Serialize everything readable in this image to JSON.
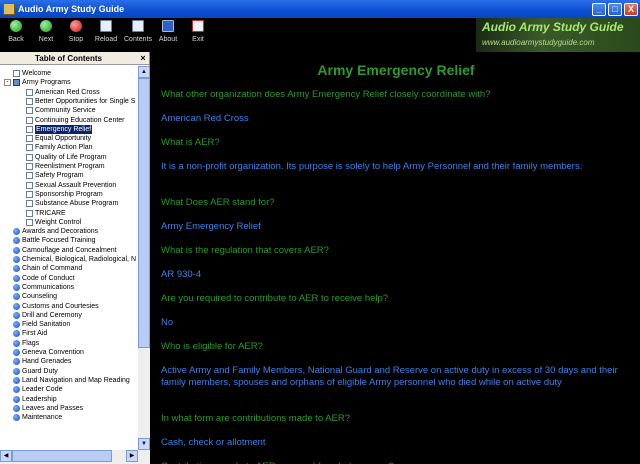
{
  "window": {
    "title": "Audio Army Study Guide",
    "min": "_",
    "max": "□",
    "close": "X"
  },
  "toolbar": {
    "back": "Back",
    "next": "Next",
    "stop": "Stop",
    "reload": "Reload",
    "contents": "Contents",
    "about": "About",
    "exit": "Exit",
    "logo_title": "Audio Army Study Guide",
    "logo_url": "www.audioarmystudyguide.com"
  },
  "toc": {
    "title": "Table of Contents",
    "close": "×",
    "items": [
      {
        "label": "Welcome",
        "icon": "page",
        "level": 1
      },
      {
        "label": "Army Programs",
        "icon": "book",
        "level": 1
      },
      {
        "label": "American Red Cross",
        "icon": "page",
        "level": 2
      },
      {
        "label": "Better Opportunities for Single S",
        "icon": "page",
        "level": 2
      },
      {
        "label": "Community Service",
        "icon": "page",
        "level": 2
      },
      {
        "label": "Continuing Education Center",
        "icon": "page",
        "level": 2
      },
      {
        "label": "Emergency Relief",
        "icon": "page",
        "level": 2,
        "selected": true
      },
      {
        "label": "Equal Opportunity",
        "icon": "page",
        "level": 2
      },
      {
        "label": "Family Action Plan",
        "icon": "page",
        "level": 2
      },
      {
        "label": "Quality of Life Program",
        "icon": "page",
        "level": 2
      },
      {
        "label": "Reenlistment Program",
        "icon": "page",
        "level": 2
      },
      {
        "label": "Safety Program",
        "icon": "page",
        "level": 2
      },
      {
        "label": "Sexual Assault Prevention",
        "icon": "page",
        "level": 2
      },
      {
        "label": "Sponsorship Program",
        "icon": "page",
        "level": 2
      },
      {
        "label": "Substance Abuse Program",
        "icon": "page",
        "level": 2
      },
      {
        "label": "TRICARE",
        "icon": "page",
        "level": 2
      },
      {
        "label": "Weight Control",
        "icon": "page",
        "level": 2
      },
      {
        "label": "Awards and Decorations",
        "icon": "q",
        "level": 1
      },
      {
        "label": "Battle Focused Training",
        "icon": "q",
        "level": 1
      },
      {
        "label": "Camouflage and Concealment",
        "icon": "q",
        "level": 1
      },
      {
        "label": "Chemical, Biological, Radiological, N",
        "icon": "q",
        "level": 1
      },
      {
        "label": "Chain of Command",
        "icon": "q",
        "level": 1
      },
      {
        "label": "Code of Conduct",
        "icon": "q",
        "level": 1
      },
      {
        "label": "Communications",
        "icon": "q",
        "level": 1
      },
      {
        "label": "Counseling",
        "icon": "q",
        "level": 1
      },
      {
        "label": "Customs and Courtesies",
        "icon": "q",
        "level": 1
      },
      {
        "label": "Drill and Ceremony",
        "icon": "q",
        "level": 1
      },
      {
        "label": "Field Sanitation",
        "icon": "q",
        "level": 1
      },
      {
        "label": "First Aid",
        "icon": "q",
        "level": 1
      },
      {
        "label": "Flags",
        "icon": "q",
        "level": 1
      },
      {
        "label": "Geneva Convention",
        "icon": "q",
        "level": 1
      },
      {
        "label": "Hand Grenades",
        "icon": "q",
        "level": 1
      },
      {
        "label": "Guard Duty",
        "icon": "q",
        "level": 1
      },
      {
        "label": "Land Navigation and Map Reading",
        "icon": "q",
        "level": 1
      },
      {
        "label": "Leader Code",
        "icon": "q",
        "level": 1
      },
      {
        "label": "Leadership",
        "icon": "q",
        "level": 1
      },
      {
        "label": "Leaves and Passes",
        "icon": "q",
        "level": 1
      },
      {
        "label": "Maintenance",
        "icon": "q",
        "level": 1
      }
    ]
  },
  "content": {
    "title": "Army Emergency Relief",
    "qa": [
      {
        "kind": "q",
        "text": "What other organization does Army Emergency Relief closely coordinate with?"
      },
      {
        "kind": "a",
        "text": "American Red Cross"
      },
      {
        "kind": "q",
        "text": "What is AER?"
      },
      {
        "kind": "a",
        "text": "It is a non-profit organization. Its purpose is solely to help Army Personnel and their family members."
      },
      {
        "kind": "q",
        "text": "What Does AER stand for?"
      },
      {
        "kind": "a",
        "text": "Army Emergency Relief"
      },
      {
        "kind": "q",
        "text": "What is the regulation that covers AER?"
      },
      {
        "kind": "a",
        "text": "AR 930-4"
      },
      {
        "kind": "q",
        "text": "Are you required to contribute to AER to receive help?"
      },
      {
        "kind": "a",
        "text": "No"
      },
      {
        "kind": "q",
        "text": "Who is eligible for AER?"
      },
      {
        "kind": "a",
        "text": "Active Army and Family Members, National Guard and Reserve on active duty in excess of 30 days and their family members, spouses and orphans of eligible Army personnel who died while on active duty"
      },
      {
        "kind": "q",
        "text": "In what form are contributions made to AER?"
      },
      {
        "kind": "a",
        "text": "Cash, check or allotment"
      },
      {
        "kind": "q",
        "text": "Contributions made to AER are used for what purpose?"
      }
    ]
  }
}
